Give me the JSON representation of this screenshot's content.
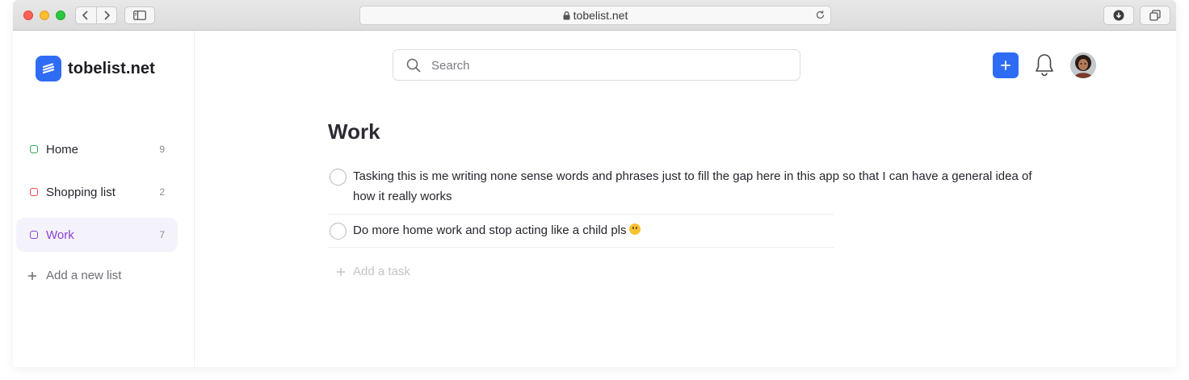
{
  "browser": {
    "url": "tobelist.net",
    "icons": [
      "back-icon",
      "forward-icon",
      "sidebar-icon",
      "lock-icon",
      "reload-icon",
      "download-icon",
      "tabs-icon"
    ]
  },
  "app": {
    "brand_name": "tobelist.net",
    "brand_color": "#2f6cf6"
  },
  "sidebar": {
    "lists": [
      {
        "label": "Home",
        "count": "9",
        "color": "#2eaa55",
        "active": false
      },
      {
        "label": "Shopping list",
        "count": "2",
        "color": "#e5484d",
        "active": false
      },
      {
        "label": "Work",
        "count": "7",
        "color": "#8a44d6",
        "active": true
      }
    ],
    "add_list_label": "Add a new list"
  },
  "header": {
    "search_placeholder": "Search",
    "icons": [
      "search-icon",
      "plus-icon",
      "bell-icon",
      "avatar"
    ]
  },
  "main": {
    "title": "Work",
    "tasks": [
      {
        "text": "Tasking this is me writing none sense words and phrases just to fill the gap here in this app so that I can have a general idea of how it really works",
        "done": false
      },
      {
        "text": "Do more home work and stop acting like a child pls",
        "emoji": "slightly-smiling-face",
        "done": false
      }
    ],
    "add_task_label": "Add a task"
  }
}
